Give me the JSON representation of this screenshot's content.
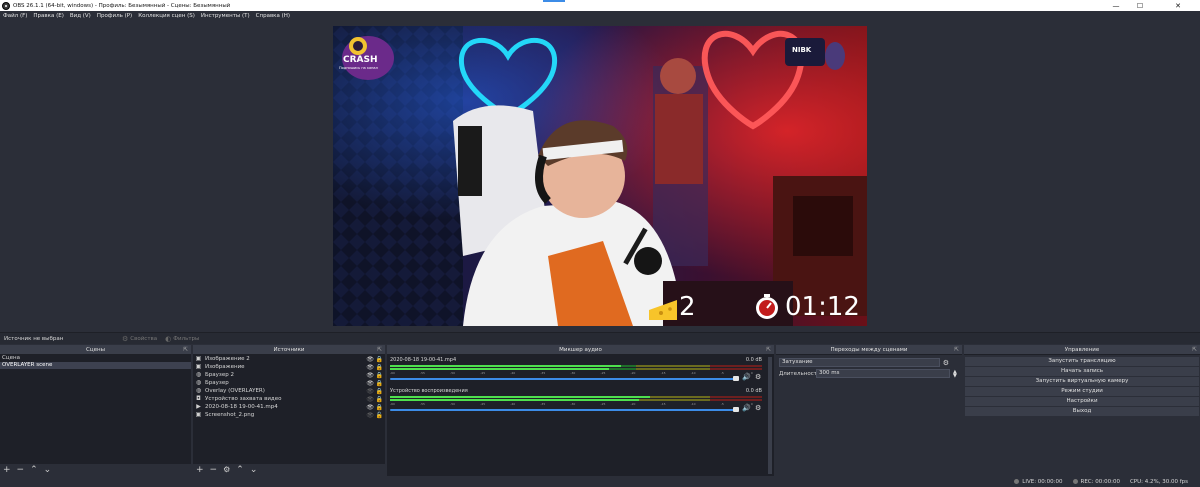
{
  "window": {
    "title": "OBS 26.1.1 (64-bit, windows) - Профиль: Безымянный - Сцены: Безымянный",
    "minimize": "—",
    "maximize": "☐",
    "close": "✕"
  },
  "menu": [
    "Файл (F)",
    "Правка (E)",
    "Вид (V)",
    "Профиль (P)",
    "Коллекция сцен (S)",
    "Инструменты (T)",
    "Справка (H)"
  ],
  "preview": {
    "logo_text": "CRASH",
    "logo_sub": "Подпишись на канал",
    "badge_text": "NIBK",
    "counter_value": "2",
    "timer_value": "01:12"
  },
  "source_bar": {
    "no_source": "Источник не выбран",
    "properties": "Свойства",
    "filters": "Фильтры"
  },
  "scenes": {
    "title": "Сцены",
    "items": [
      "Сцена",
      "OVERLAYER scene"
    ],
    "selected_index": 1
  },
  "sources": {
    "title": "Источники",
    "items": [
      {
        "label": "Изображение 2",
        "icon": "image-icon",
        "visible": true,
        "locked": true
      },
      {
        "label": "Изображение",
        "icon": "image-icon",
        "visible": true,
        "locked": true
      },
      {
        "label": "Браузер 2",
        "icon": "globe-icon",
        "visible": true,
        "locked": true
      },
      {
        "label": "Браузер",
        "icon": "globe-icon",
        "visible": true,
        "locked": true
      },
      {
        "label": "Overlay (OVERLAYER)",
        "icon": "globe-icon",
        "visible": false,
        "locked": true
      },
      {
        "label": "Устройство захвата видео",
        "icon": "camera-icon",
        "visible": false,
        "locked": true
      },
      {
        "label": "2020-08-18 19-00-41.mp4",
        "icon": "play-icon",
        "visible": true,
        "locked": true
      },
      {
        "label": "Screenshot_2.png",
        "icon": "image-icon",
        "visible": false,
        "locked": false
      }
    ]
  },
  "mixer": {
    "title": "Микшер аудио",
    "channels": [
      {
        "name": "2020-08-18 19-00-41.mp4",
        "db": "0.0 dB",
        "level": 0.62,
        "volume": 1.0
      },
      {
        "name": "Устройство воспроизведения",
        "db": "0.0 dB",
        "level": 0.7,
        "volume": 1.0
      }
    ],
    "ticks": [
      "-60",
      "-55",
      "-50",
      "-45",
      "-40",
      "-35",
      "-30",
      "-25",
      "-20",
      "-15",
      "-10",
      "-5",
      "0"
    ]
  },
  "transitions": {
    "title": "Переходы между сценами",
    "type": "Затухание",
    "duration_label": "Длительность",
    "duration_value": "300 ms"
  },
  "controls": {
    "title": "Управление",
    "buttons": [
      "Запустить трансляцию",
      "Начать запись",
      "Запустить виртуальную камеру",
      "Режим студии",
      "Настройки",
      "Выход"
    ]
  },
  "status": {
    "live": "LIVE: 00:00:00",
    "rec": "REC: 00:00:00",
    "cpu": "CPU: 4.2%, 30.00 fps"
  },
  "colors": {
    "accent": "#3c8ce7",
    "background": "#2b2e38",
    "panel": "#1e2028"
  }
}
